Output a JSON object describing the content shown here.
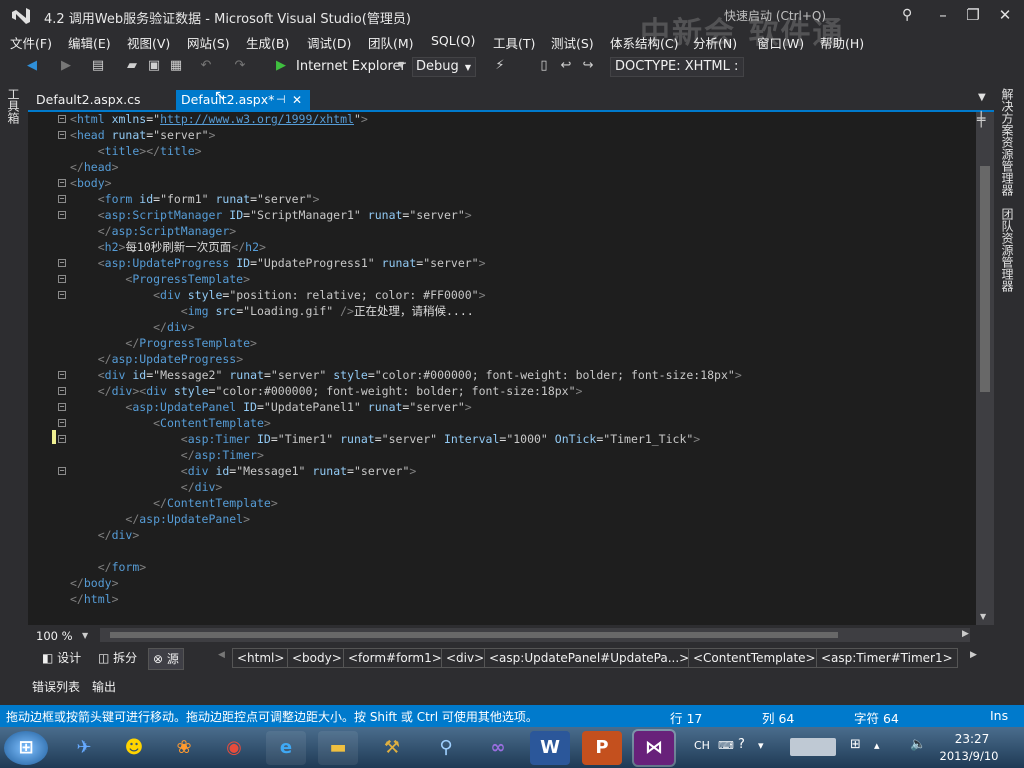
{
  "window": {
    "title": "4.2  调用Web服务验证数据 - Microsoft Visual Studio(管理员)",
    "quick_launch": "快速启动 (Ctrl+Q)",
    "watermark": "中新会 软件通"
  },
  "menu": [
    "文件(F)",
    "编辑(E)",
    "视图(V)",
    "网站(S)",
    "生成(B)",
    "调试(D)",
    "团队(M)",
    "SQL(Q)",
    "工具(T)",
    "测试(S)",
    "体系结构(C)",
    "分析(N)",
    "窗口(W)",
    "帮助(H)"
  ],
  "toolbar": {
    "run_target": "Internet Explorer",
    "configuration": "Debug",
    "doctype": "DOCTYPE:  XHTML :"
  },
  "side_tabs": {
    "left": "工具箱",
    "right": [
      "解决方案资源管理器",
      "团队资源管理器"
    ]
  },
  "tabs": [
    {
      "label": "Default2.aspx.cs"
    },
    {
      "label": "Default2.aspx*"
    }
  ],
  "code": {
    "url": "http://www.w3.org/1999/xhtml",
    "h2_text": "每10秒刷新一次页面",
    "progress_text": "正在处理，请稍候...."
  },
  "editor": {
    "zoom": "100 %"
  },
  "view_buttons": [
    "设计",
    "拆分",
    "源"
  ],
  "breadcrumbs": [
    "<html>",
    "<body>",
    "<form#form1>",
    "<div>",
    "<asp:UpdatePanel#UpdatePa...>",
    "<ContentTemplate>",
    "<asp:Timer#Timer1>"
  ],
  "panel_tabs": [
    "错误列表",
    "输出"
  ],
  "status": {
    "message": "拖动边框或按箭头键可进行移动。拖动边距控点可调整边距大小。按 Shift 或 Ctrl 可使用其他选项。",
    "line": "行 17",
    "col": "列 64",
    "char": "字符 64",
    "mode": "Ins"
  },
  "taskbar": {
    "ime": "CH",
    "time": "23:27",
    "date": "2013/9/10"
  }
}
